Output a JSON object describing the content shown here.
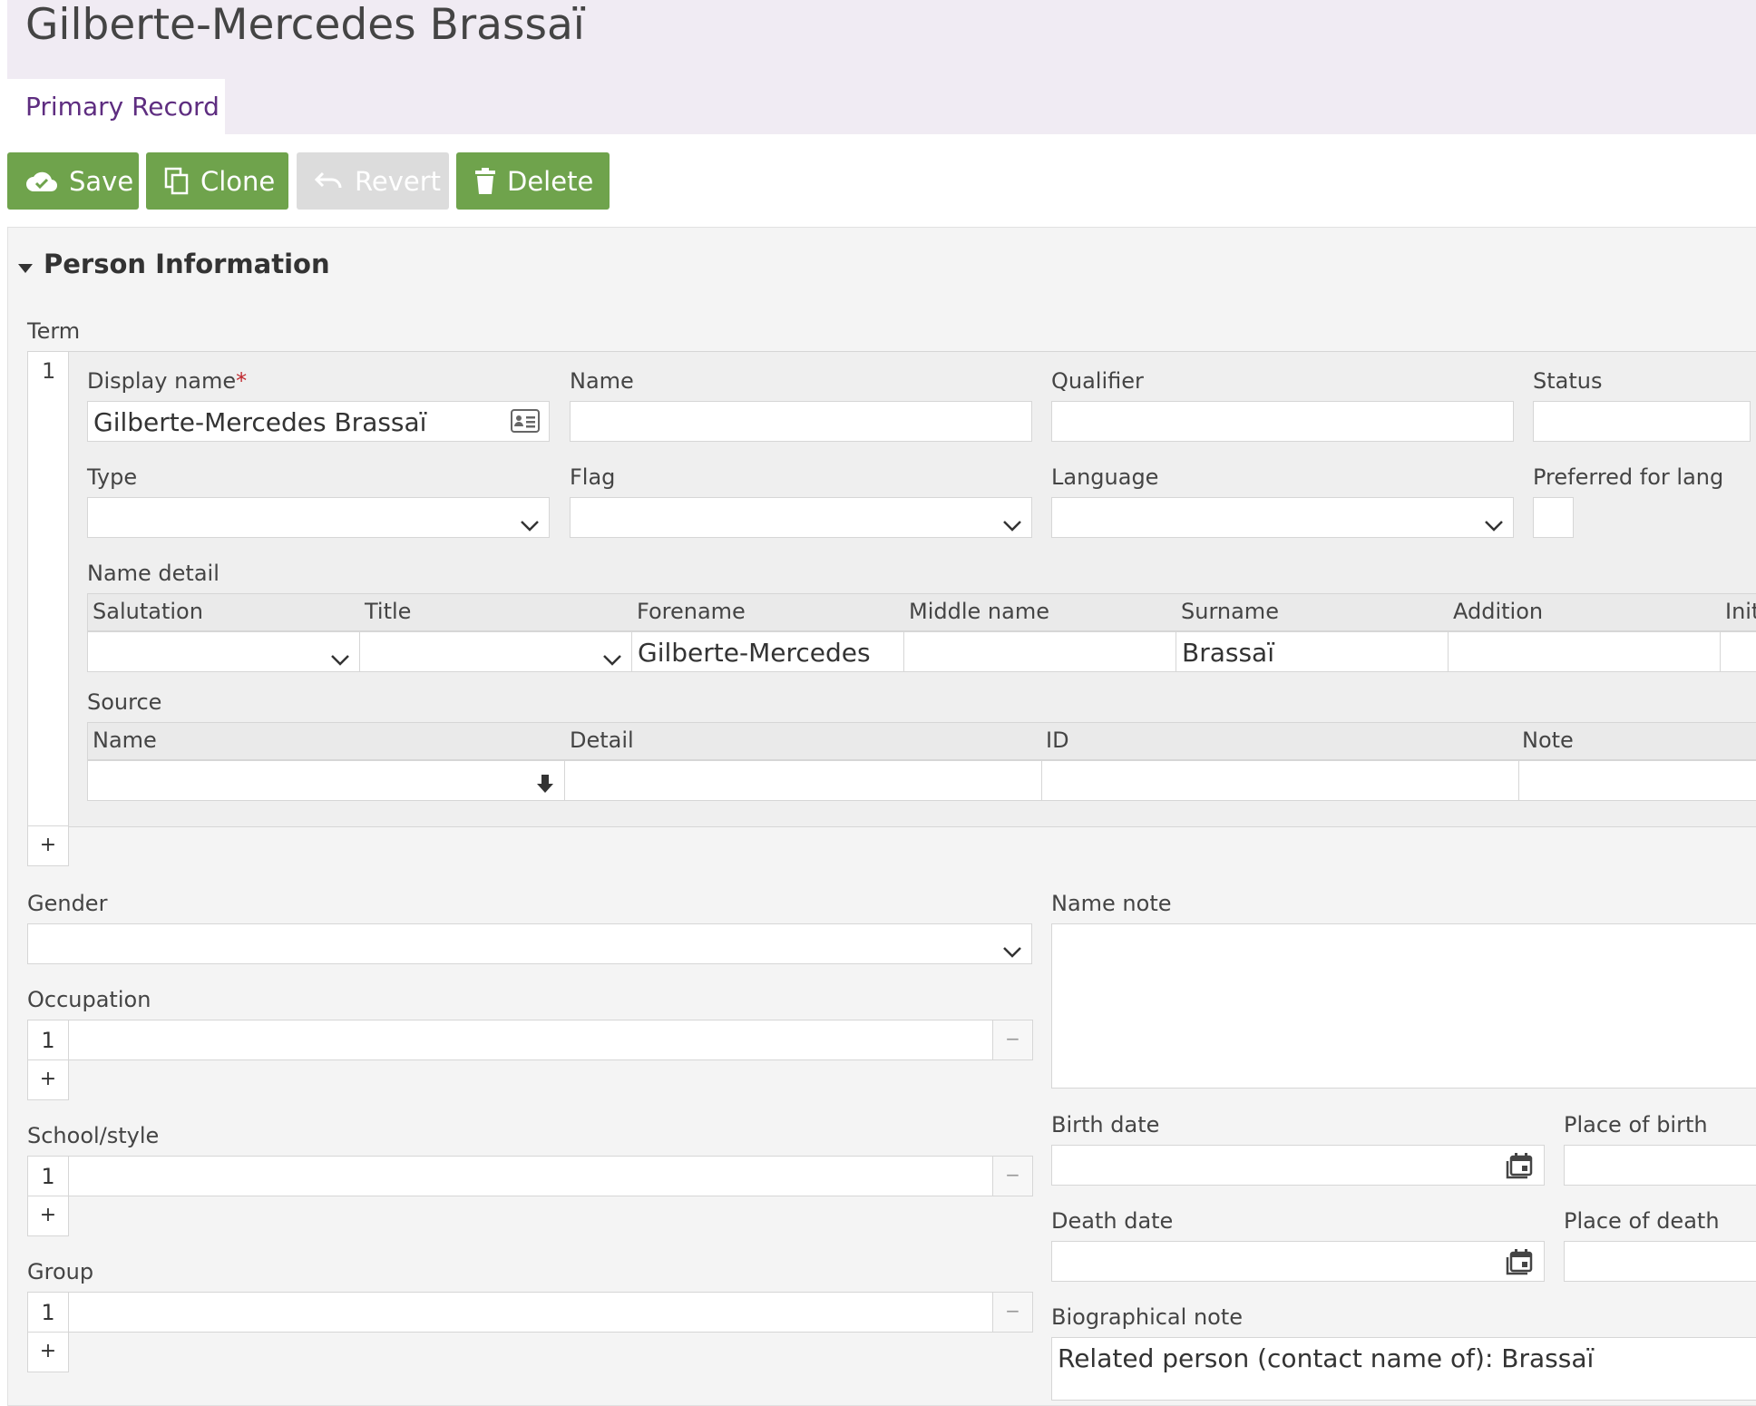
{
  "record": {
    "title": "Gilberte-Mercedes Brassaï"
  },
  "tabs": [
    {
      "label": "Primary Record"
    }
  ],
  "toolbar": {
    "save_label": "Save",
    "clone_label": "Clone",
    "revert_label": "Revert",
    "delete_label": "Delete"
  },
  "section": {
    "title": "Person Information"
  },
  "term": {
    "label": "Term",
    "index": "1",
    "display_name_label": "Display name",
    "required_mark": "*",
    "display_name_value": "Gilberte-Mercedes Brassaï",
    "name_label": "Name",
    "qualifier_label": "Qualifier",
    "status_label": "Status",
    "type_label": "Type",
    "flag_label": "Flag",
    "language_label": "Language",
    "preferred_label": "Preferred for lang",
    "name_detail_label": "Name detail",
    "name_detail_columns": [
      "Salutation",
      "Title",
      "Forename",
      "Middle name",
      "Surname",
      "Addition",
      "Init"
    ],
    "forename_value": "Gilberte-Mercedes",
    "surname_value": "Brassaï",
    "source_label": "Source",
    "source_columns": [
      "Name",
      "Detail",
      "ID",
      "Note"
    ],
    "add_label": "+"
  },
  "gender": {
    "label": "Gender"
  },
  "occupation": {
    "label": "Occupation",
    "index": "1",
    "add": "+",
    "remove": "−"
  },
  "school": {
    "label": "School/style",
    "index": "1",
    "add": "+",
    "remove": "−"
  },
  "group": {
    "label": "Group",
    "index": "1",
    "add": "+",
    "remove": "−"
  },
  "name_note": {
    "label": "Name note"
  },
  "birth": {
    "date_label": "Birth date",
    "place_label": "Place of birth"
  },
  "death": {
    "date_label": "Death date",
    "place_label": "Place of death"
  },
  "bio": {
    "label": "Biographical note",
    "value": "Related person (contact name of): Brassaï"
  },
  "colors": {
    "accent": "#6fa34c",
    "header_bg": "#f0ebf3",
    "tab_text": "#5e2d80",
    "required": "#c0272d"
  }
}
